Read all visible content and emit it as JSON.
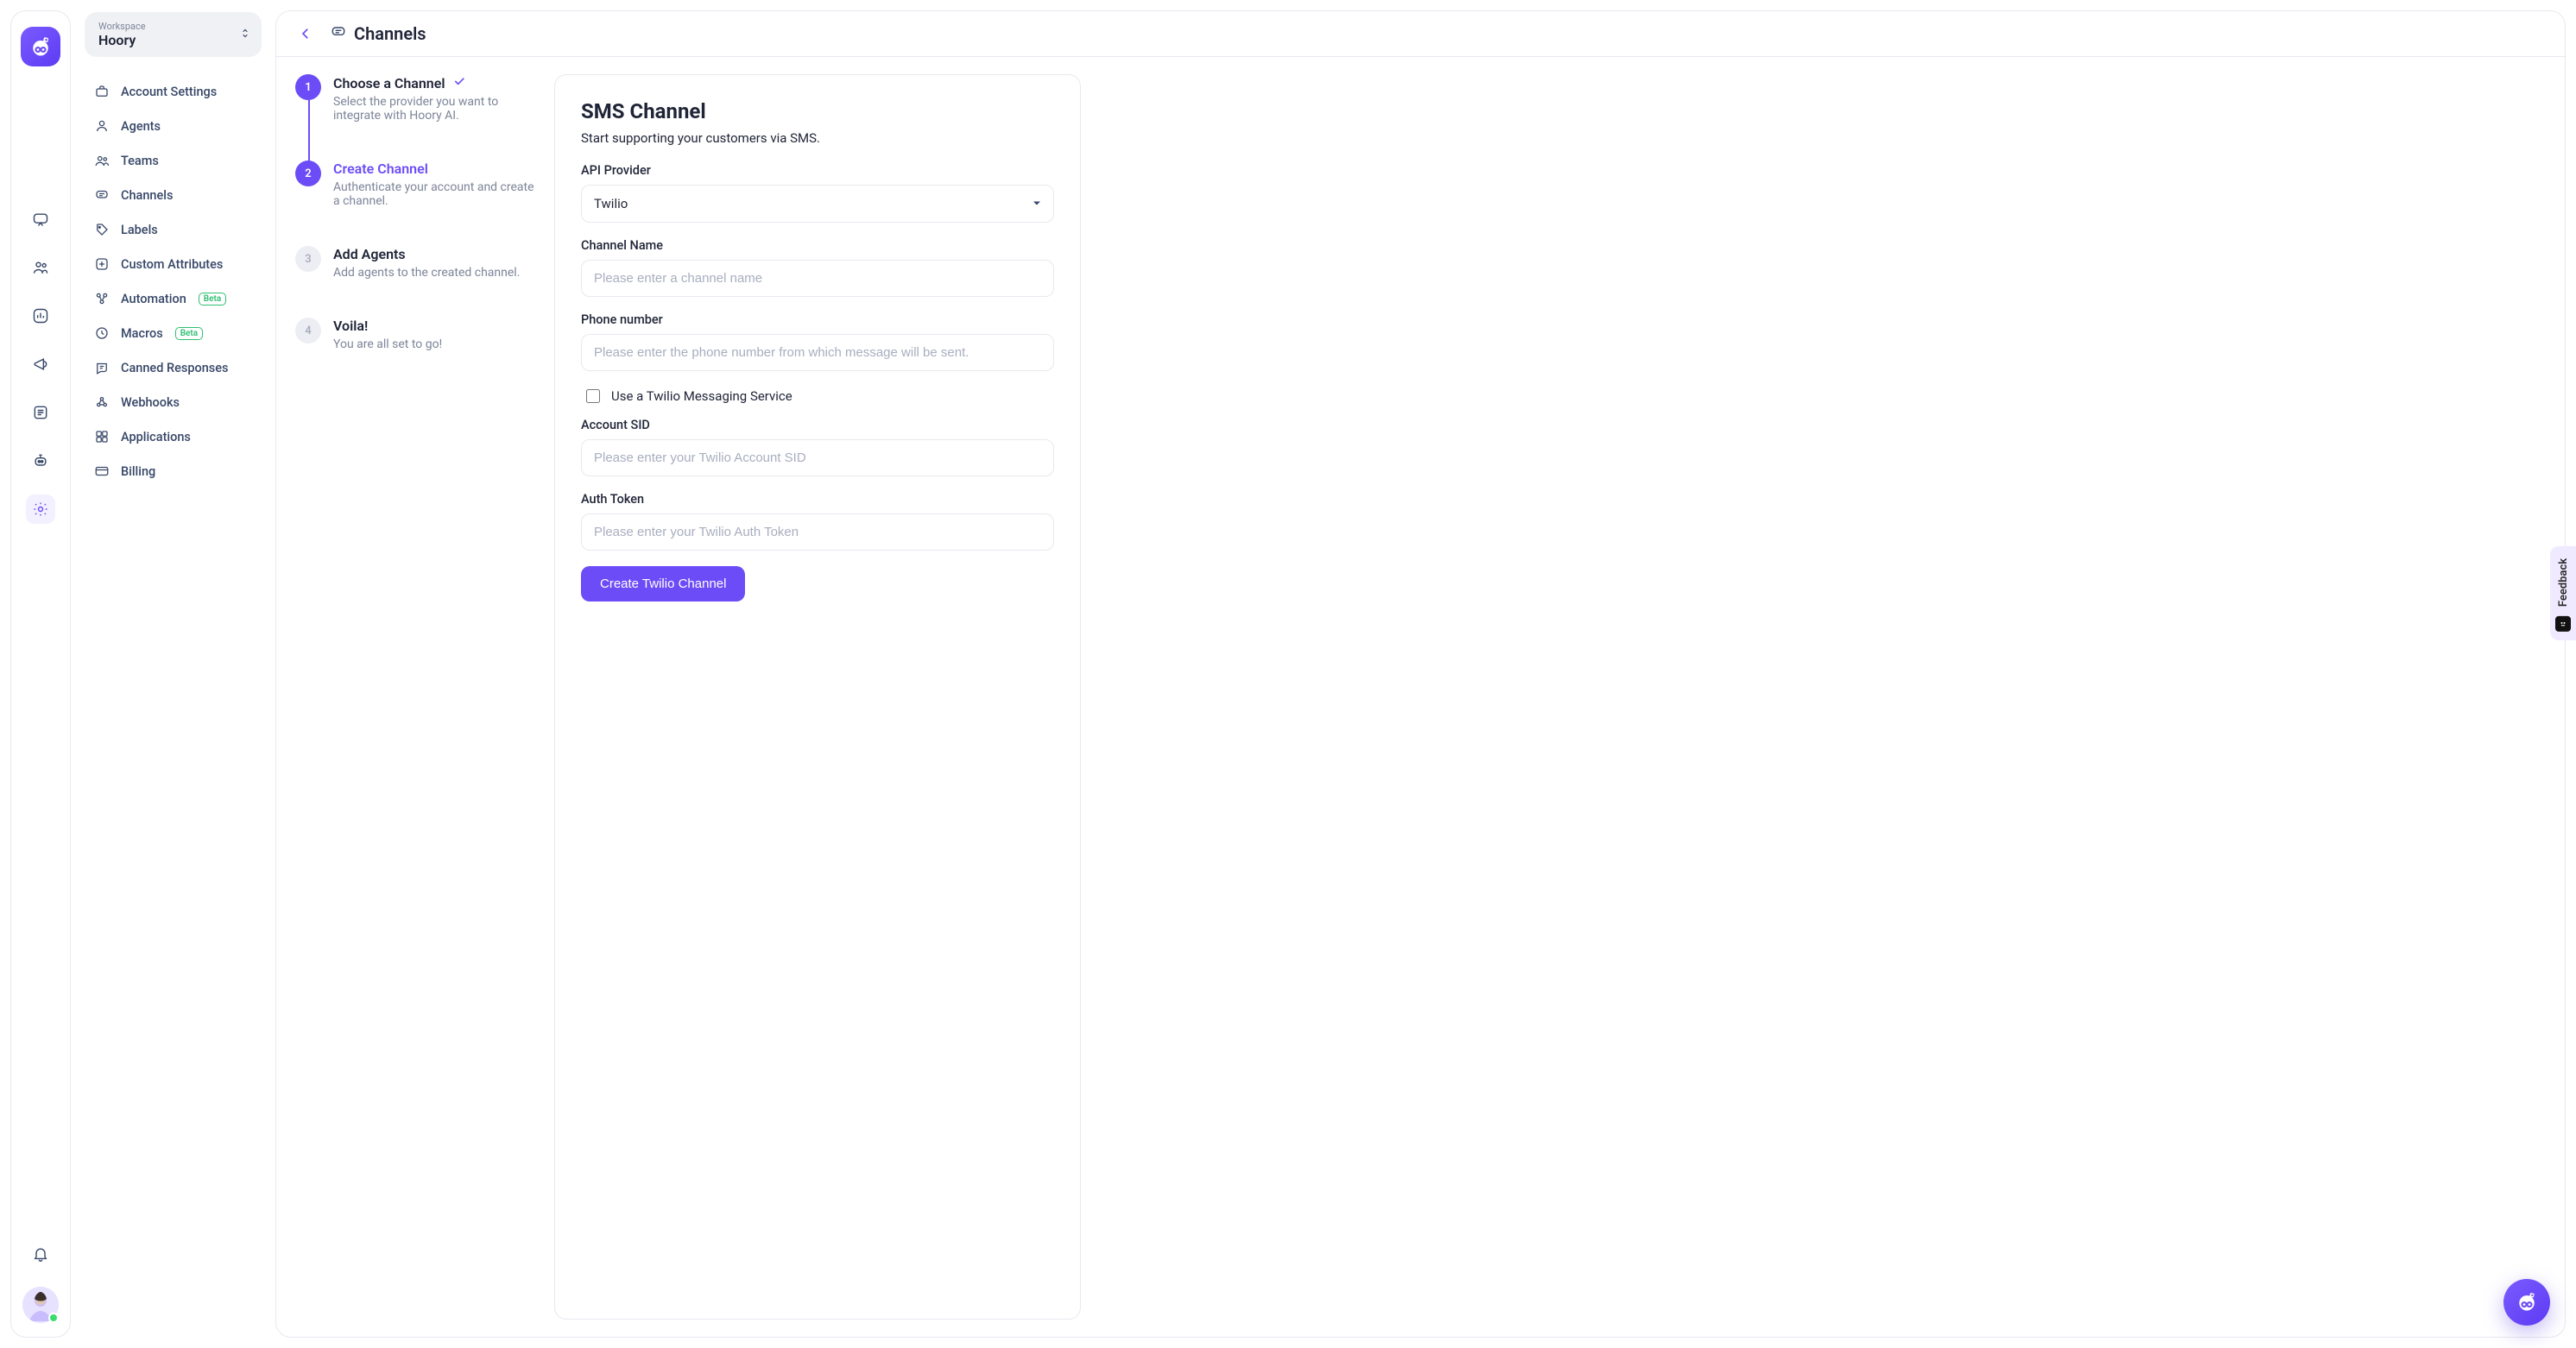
{
  "workspace": {
    "label": "Workspace",
    "name": "Hoory"
  },
  "sidebar": {
    "items": [
      {
        "label": "Account Settings",
        "icon": "briefcase-icon"
      },
      {
        "label": "Agents",
        "icon": "user-icon"
      },
      {
        "label": "Teams",
        "icon": "users-icon"
      },
      {
        "label": "Channels",
        "icon": "channel-icon"
      },
      {
        "label": "Labels",
        "icon": "tag-icon"
      },
      {
        "label": "Custom Attributes",
        "icon": "attributes-icon"
      },
      {
        "label": "Automation",
        "icon": "automation-icon",
        "badge": "Beta"
      },
      {
        "label": "Macros",
        "icon": "macro-icon",
        "badge": "Beta"
      },
      {
        "label": "Canned Responses",
        "icon": "canned-icon"
      },
      {
        "label": "Webhooks",
        "icon": "webhook-icon"
      },
      {
        "label": "Applications",
        "icon": "applications-icon"
      },
      {
        "label": "Billing",
        "icon": "billing-icon"
      }
    ]
  },
  "header": {
    "title": "Channels"
  },
  "stepper": [
    {
      "title": "Choose a Channel",
      "desc": "Select the provider you want to integrate with Hoory AI.",
      "state": "done"
    },
    {
      "title": "Create Channel",
      "desc": "Authenticate your account and create a channel.",
      "state": "active"
    },
    {
      "title": "Add Agents",
      "desc": "Add agents to the created channel.",
      "state": "pending"
    },
    {
      "title": "Voila!",
      "desc": "You are all set to go!",
      "state": "pending"
    }
  ],
  "form": {
    "title": "SMS Channel",
    "subtitle": "Start supporting your customers via SMS.",
    "api_provider_label": "API Provider",
    "api_provider_value": "Twilio",
    "channel_name_label": "Channel Name",
    "channel_name_placeholder": "Please enter a channel name",
    "phone_label": "Phone number",
    "phone_placeholder": "Please enter the phone number from which message will be sent.",
    "twilio_service_checkbox_label": "Use a Twilio Messaging Service",
    "account_sid_label": "Account SID",
    "account_sid_placeholder": "Please enter your Twilio Account SID",
    "auth_token_label": "Auth Token",
    "auth_token_placeholder": "Please enter your Twilio Auth Token",
    "submit_label": "Create Twilio Channel"
  },
  "feedback": {
    "label": "Feedback"
  }
}
